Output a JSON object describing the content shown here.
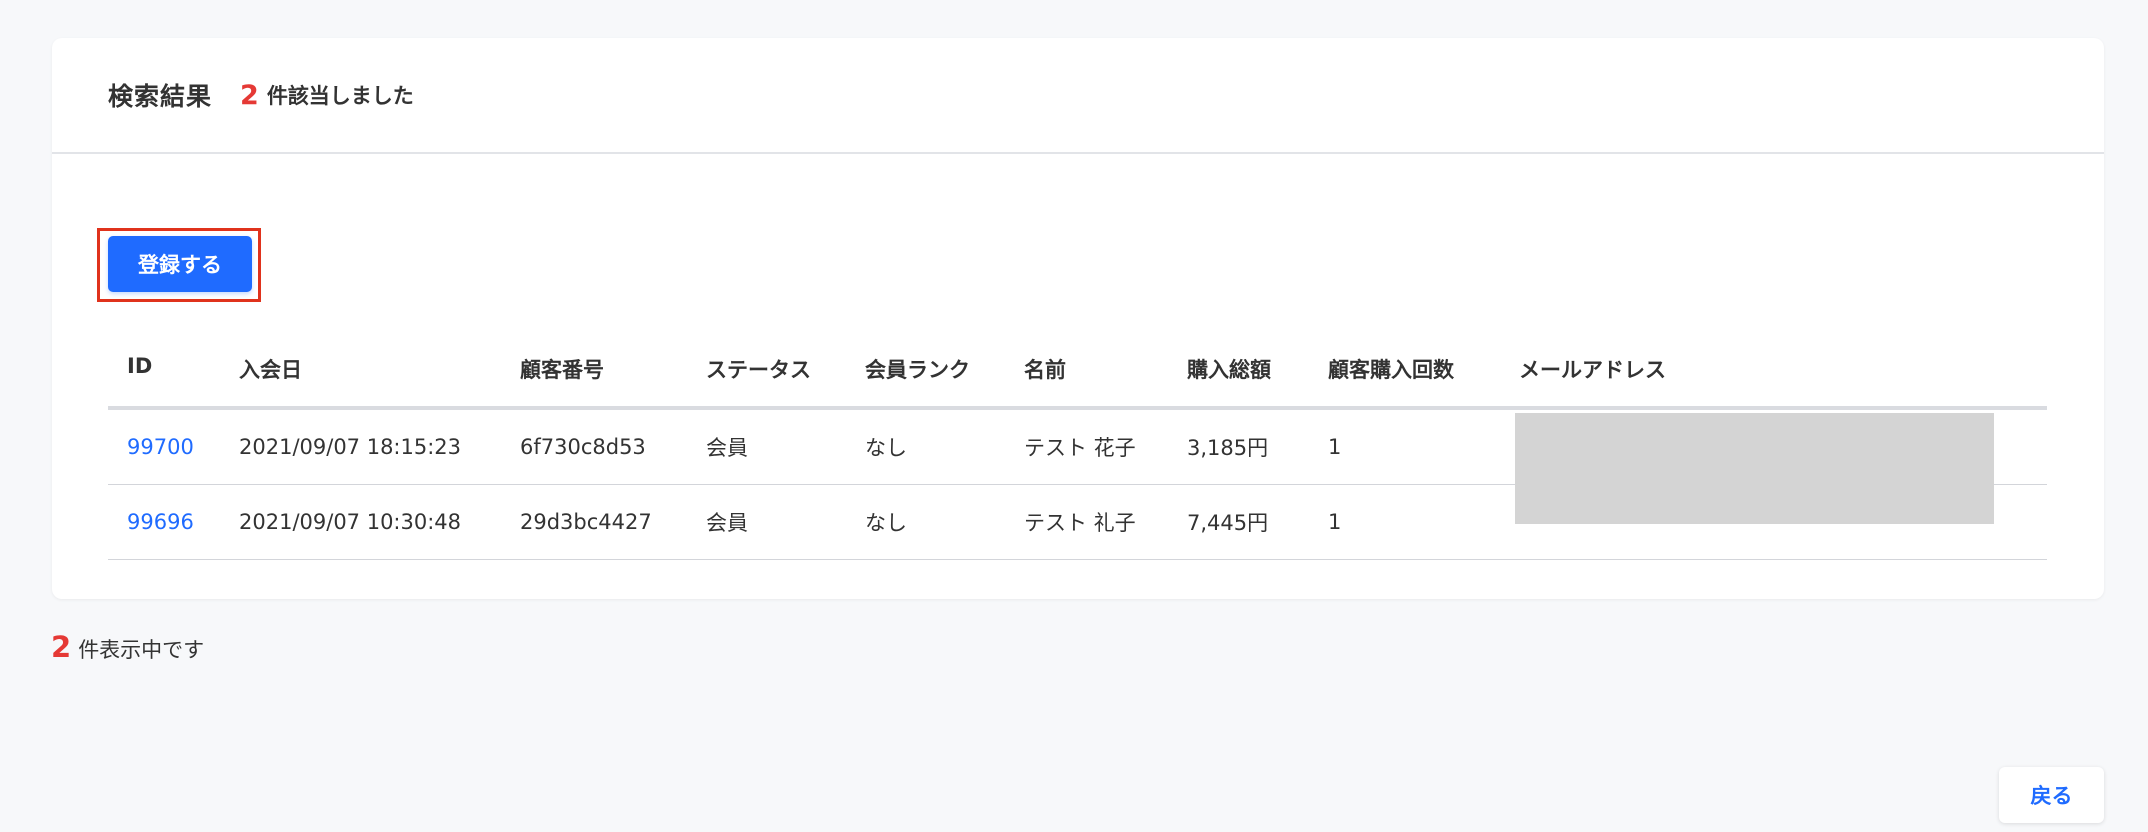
{
  "header": {
    "title": "検索結果",
    "count": "2",
    "suffix": "件該当しました"
  },
  "actions": {
    "register_label": "登録する",
    "back_label": "戻る"
  },
  "table": {
    "columns": [
      "ID",
      "入会日",
      "顧客番号",
      "ステータス",
      "会員ランク",
      "名前",
      "購入総額",
      "顧客購入回数",
      "メールアドレス"
    ],
    "rows": [
      {
        "id": "99700",
        "joined": "2021/09/07 18:15:23",
        "customer_no": "6f730c8d53",
        "status": "会員",
        "rank": "なし",
        "name": "テスト 花子",
        "total": "3,185円",
        "purchases": "1",
        "email": ""
      },
      {
        "id": "99696",
        "joined": "2021/09/07 10:30:48",
        "customer_no": "29d3bc4427",
        "status": "会員",
        "rank": "なし",
        "name": "テスト 礼子",
        "total": "7,445円",
        "purchases": "1",
        "email": ""
      }
    ]
  },
  "footer": {
    "count": "2",
    "text": "件表示中です"
  },
  "colors": {
    "accent": "#1f6bff",
    "count_red": "#e53935",
    "highlight_frame": "#e0321c",
    "redaction": "#d4d4d4"
  }
}
